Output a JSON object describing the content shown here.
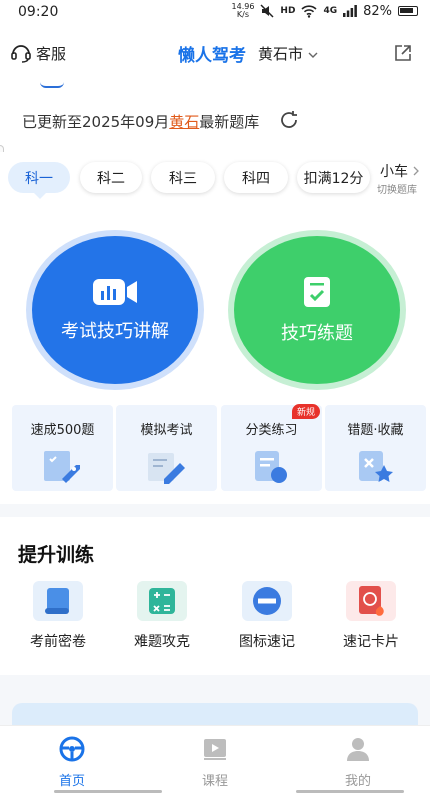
{
  "status_bar": {
    "time": "09:20",
    "net_speed_value": "14.96",
    "net_speed_unit": "K/s",
    "hd": "HD",
    "signal": "4G",
    "battery": "82%"
  },
  "header": {
    "service_label": "客服",
    "brand": "懒人驾考",
    "city": "黄石市"
  },
  "notice": {
    "prefix": "已更新至2025年09月",
    "city": "黄石",
    "suffix": "最新题库"
  },
  "tabs": {
    "items": [
      "科一",
      "科二",
      "科三",
      "科四",
      "扣满12分"
    ],
    "active": "科一",
    "car_label": "小车",
    "switch_label": "切换题库"
  },
  "hero": {
    "left_label": "考试技巧讲解",
    "right_label": "技巧练题",
    "left_color": "#2374e8",
    "right_color": "#3ecf6b"
  },
  "features": [
    {
      "label": "速成500题",
      "icon": "rocket-doc-icon"
    },
    {
      "label": "模拟考试",
      "icon": "pencil-paper-icon"
    },
    {
      "label": "分类练习",
      "icon": "category-doc-icon",
      "badge": "新规"
    },
    {
      "label": "错题·收藏",
      "icon": "wrong-star-icon"
    }
  ],
  "training": {
    "title": "提升训练",
    "items": [
      {
        "label": "考前密卷",
        "icon": "scroll-icon"
      },
      {
        "label": "难题攻克",
        "icon": "calculator-icon"
      },
      {
        "label": "图标速记",
        "icon": "no-entry-sign-icon"
      },
      {
        "label": "速记卡片",
        "icon": "flash-card-icon"
      }
    ]
  },
  "bottom_nav": {
    "items": [
      {
        "label": "首页",
        "icon": "steering-wheel-icon"
      },
      {
        "label": "课程",
        "icon": "video-play-icon"
      },
      {
        "label": "我的",
        "icon": "person-icon"
      }
    ],
    "active": "首页",
    "active_color": "#1a73e8"
  }
}
